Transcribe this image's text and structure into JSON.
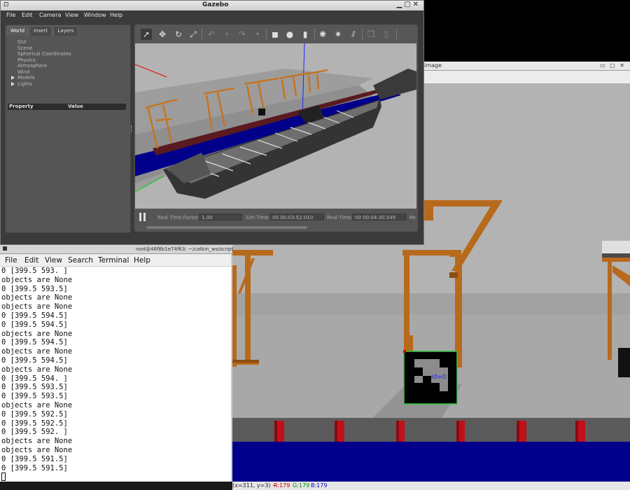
{
  "image_view": {
    "title": "image",
    "window_buttons": "▭ ▢ ✕",
    "status": {
      "coords": "(x=311, y=3) ~ ",
      "r": "R:179",
      "g": "G:179",
      "b": "B:179"
    },
    "marker_label": "id=0"
  },
  "gazebo": {
    "title": "Gazebo",
    "menu": [
      "File",
      "Edit",
      "Camera",
      "View",
      "Window",
      "Help"
    ],
    "tabs": [
      "World",
      "Insert",
      "Layers"
    ],
    "world_items": [
      "GUI",
      "Scene",
      "Spherical Coordinates",
      "Physics",
      "Atmosphere",
      "Wind",
      "Models",
      "Lights"
    ],
    "property_header": {
      "property": "Property",
      "value": "Value"
    },
    "toolbar_icons": [
      "select-arrow-icon",
      "translate-icon",
      "rotate-icon",
      "scale-icon",
      "undo-icon",
      "redo-icon",
      "box-icon",
      "sphere-icon",
      "cylinder-icon",
      "point-light-icon",
      "spot-light-icon",
      "directional-light-icon",
      "copy-icon",
      "paste-icon"
    ],
    "status": {
      "rtf_label": "Real Time Factor:",
      "rtf_value": "1.00",
      "sim_label": "Sim Time:",
      "sim_value": "00 00:03:52.010",
      "real_label": "Real Time:",
      "real_value": "00 00:04:30.549",
      "trailing": "Re"
    }
  },
  "terminal": {
    "title": "root@46f8b1e74f63: ~/catkin_ws/script",
    "menu": [
      "File",
      "Edit",
      "View",
      "Search",
      "Terminal",
      "Help"
    ],
    "lines": [
      "0 [399.5 593. ]",
      "objects are None",
      "0 [399.5 593.5]",
      "objects are None",
      "objects are None",
      "0 [399.5 594.5]",
      "0 [399.5 594.5]",
      "objects are None",
      "0 [399.5 594.5]",
      "objects are None",
      "0 [399.5 594.5]",
      "objects are None",
      "0 [399.5 594. ]",
      "0 [399.5 593.5]",
      "0 [399.5 593.5]",
      "objects are None",
      "0 [399.5 592.5]",
      "0 [399.5 592.5]",
      "0 [399.5 592. ]",
      "objects are None",
      "objects are None",
      "0 [399.5 591.5]",
      "0 [399.5 591.5]"
    ]
  },
  "colors": {
    "crane_orange": "#b86a1c",
    "ship_hull": "#3a3a3a",
    "water_blue": "#00008a",
    "bollard_red": "#c0101a",
    "marker_green": "#2ecc40"
  }
}
